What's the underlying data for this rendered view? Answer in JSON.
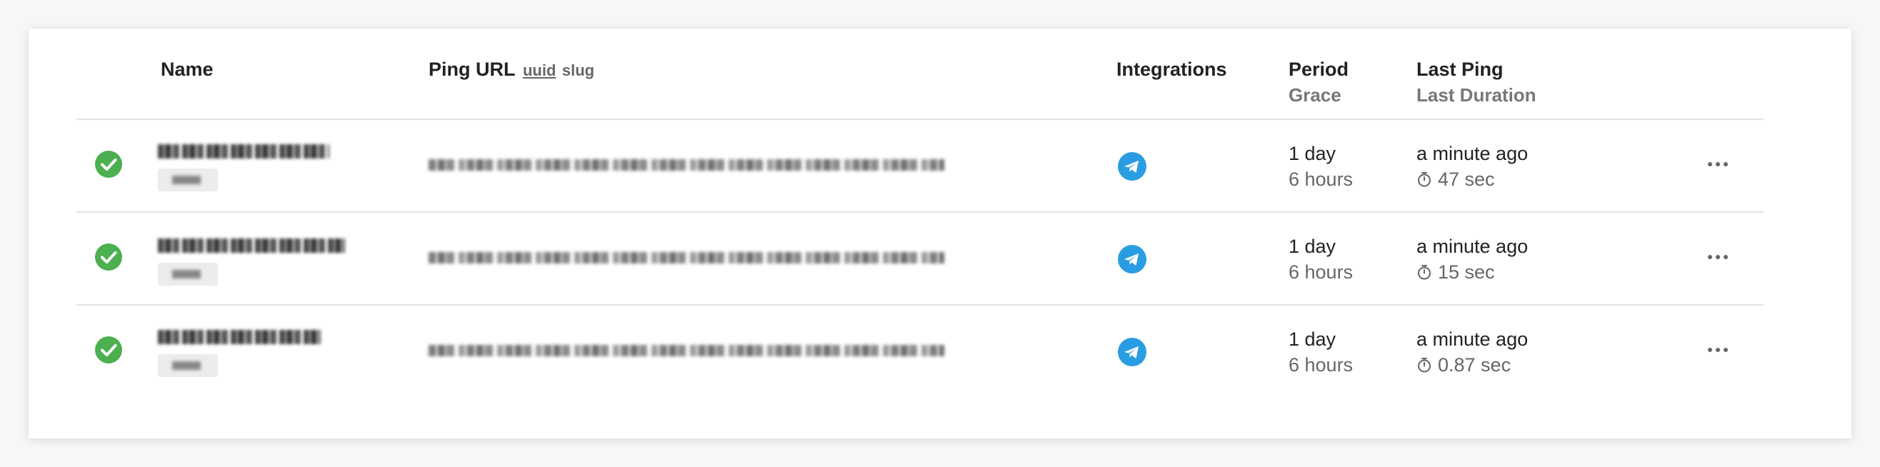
{
  "table": {
    "columns": {
      "name": "Name",
      "ping_url": "Ping URL",
      "ping_url_mode_uuid": "uuid",
      "ping_url_mode_slug": "slug",
      "integrations": "Integrations",
      "period": "Period",
      "grace": "Grace",
      "last_ping": "Last Ping",
      "last_duration": "Last Duration"
    },
    "rows": [
      {
        "status": "up",
        "integration_icon": "telegram-icon",
        "period": "1 day",
        "grace": "6 hours",
        "last_ping": "a minute ago",
        "last_duration": "47 sec"
      },
      {
        "status": "up",
        "integration_icon": "telegram-icon",
        "period": "1 day",
        "grace": "6 hours",
        "last_ping": "a minute ago",
        "last_duration": "15 sec"
      },
      {
        "status": "up",
        "integration_icon": "telegram-icon",
        "period": "1 day",
        "grace": "6 hours",
        "last_ping": "a minute ago",
        "last_duration": "0.87 sec"
      }
    ]
  },
  "colors": {
    "status_up": "#4caf50",
    "telegram": "#2a9de2",
    "muted_text": "#666666",
    "divider": "#e3e3e3"
  }
}
